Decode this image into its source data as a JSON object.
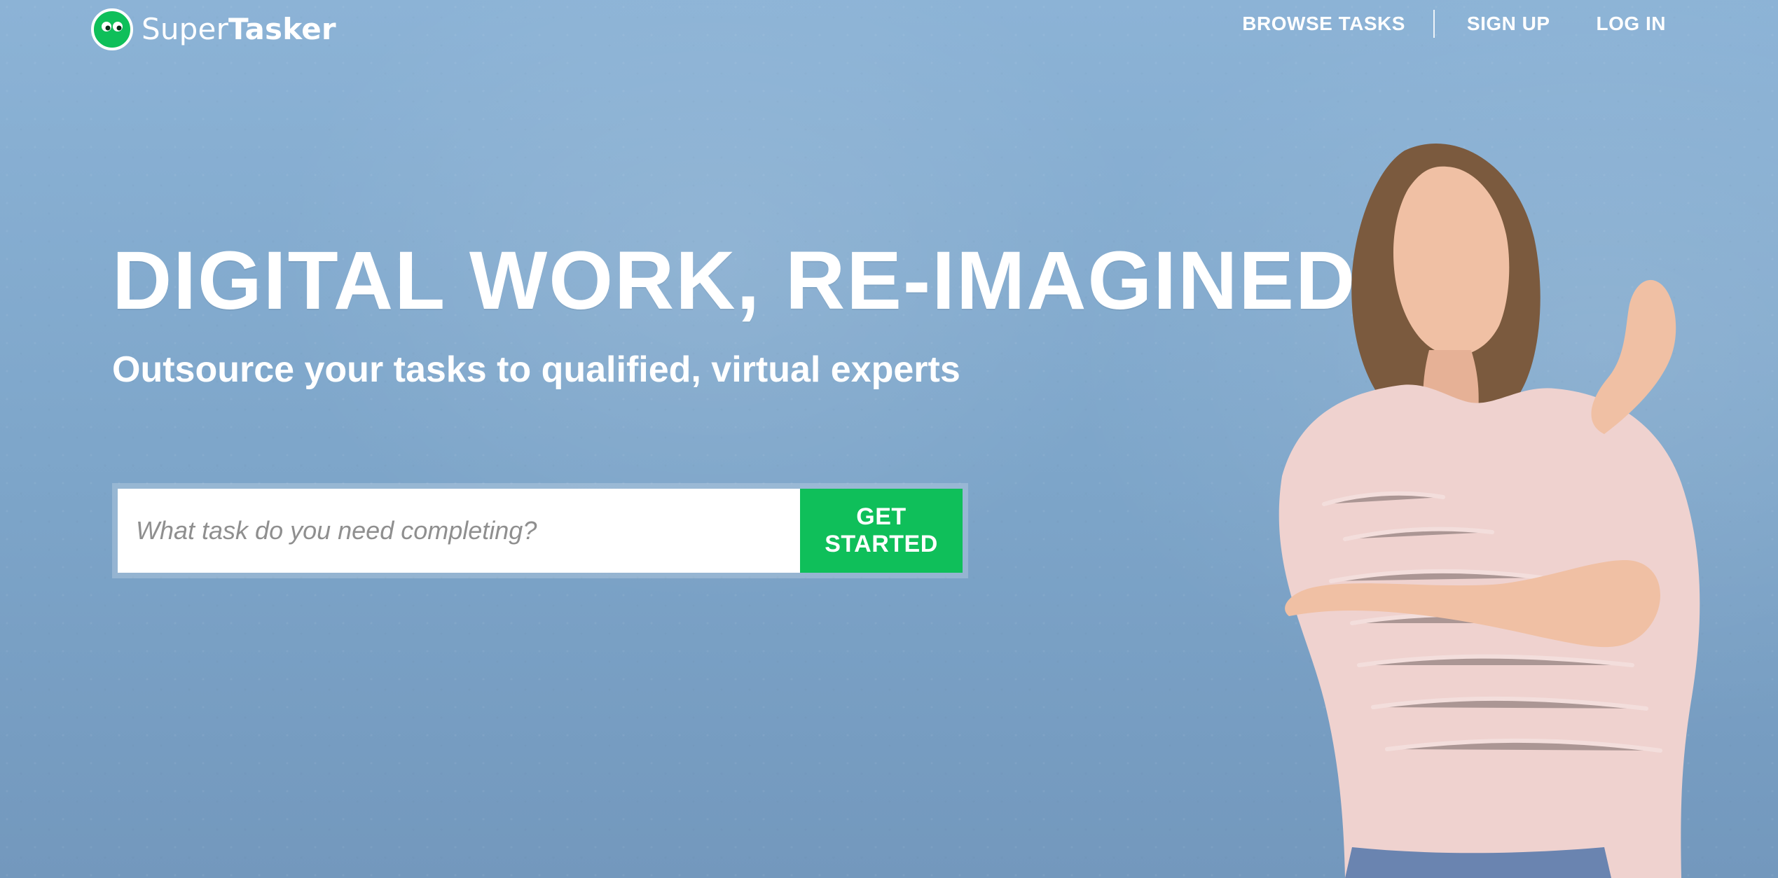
{
  "brand": {
    "name_light": "Super",
    "name_bold": "Tasker",
    "accent": "#0fbf5a",
    "logo_icon": "smiley-eyes-icon"
  },
  "nav": {
    "items": [
      {
        "label": "BROWSE TASKS"
      },
      {
        "label": "SIGN UP"
      },
      {
        "label": "LOG IN"
      }
    ]
  },
  "hero": {
    "headline": "DIGITAL WORK, RE-IMAGINED",
    "subheadline": "Outsource your tasks to qualified, virtual experts",
    "search": {
      "placeholder": "What task do you need completing?",
      "value": ""
    },
    "cta_label": "GET STARTED",
    "background_color": "#7fa6c9"
  }
}
